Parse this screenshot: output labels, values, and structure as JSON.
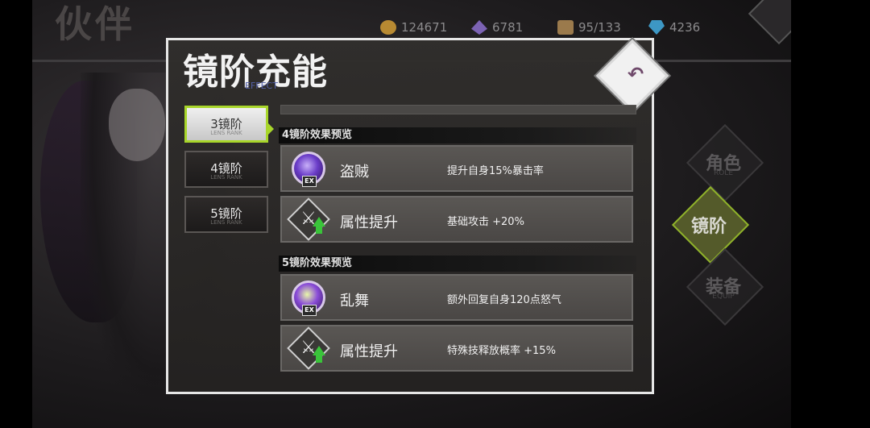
{
  "background": {
    "title": "伙伴",
    "resources": [
      {
        "icon": "coin-icon",
        "value": "124671"
      },
      {
        "icon": "crystal-icon",
        "value": "6781"
      },
      {
        "icon": "box-icon",
        "value": "95/133"
      },
      {
        "icon": "gem-icon",
        "value": "4236"
      }
    ],
    "side_menu": [
      {
        "label": "角色",
        "sub": "ROLE"
      },
      {
        "label": "镜阶",
        "sub": ""
      },
      {
        "label": "装备",
        "sub": "EQUIP"
      }
    ]
  },
  "modal": {
    "title": "镜阶充能",
    "subtitle": "EFFECT",
    "back_icon": "undo-arrow-icon",
    "tabs": [
      {
        "label": "3镜阶",
        "sub": "LENS RANK",
        "active": true
      },
      {
        "label": "4镜阶",
        "sub": "LENS RANK",
        "active": false
      },
      {
        "label": "5镜阶",
        "sub": "LENS RANK",
        "active": false
      }
    ],
    "sections": [
      {
        "header": "4镜阶效果预览",
        "rows": [
          {
            "icon": "skill-orb-icon",
            "badge": "EX",
            "name": "盗贼",
            "desc": "提升自身15%暴击率"
          },
          {
            "icon": "crossed-swords-icon",
            "name": "属性提升",
            "desc": "基础攻击 +20%"
          }
        ]
      },
      {
        "header": "5镜阶效果预览",
        "rows": [
          {
            "icon": "skill-orb-icon",
            "badge": "EX",
            "name": "乱舞",
            "desc": "额外回复自身120点怒气"
          },
          {
            "icon": "crossed-swords-icon",
            "name": "属性提升",
            "desc": "特殊技释放概率 +15%"
          }
        ]
      }
    ]
  },
  "colors": {
    "accent": "#a8d62a",
    "frame": "#e6e6e6",
    "stat_up": "#3ac43a"
  }
}
